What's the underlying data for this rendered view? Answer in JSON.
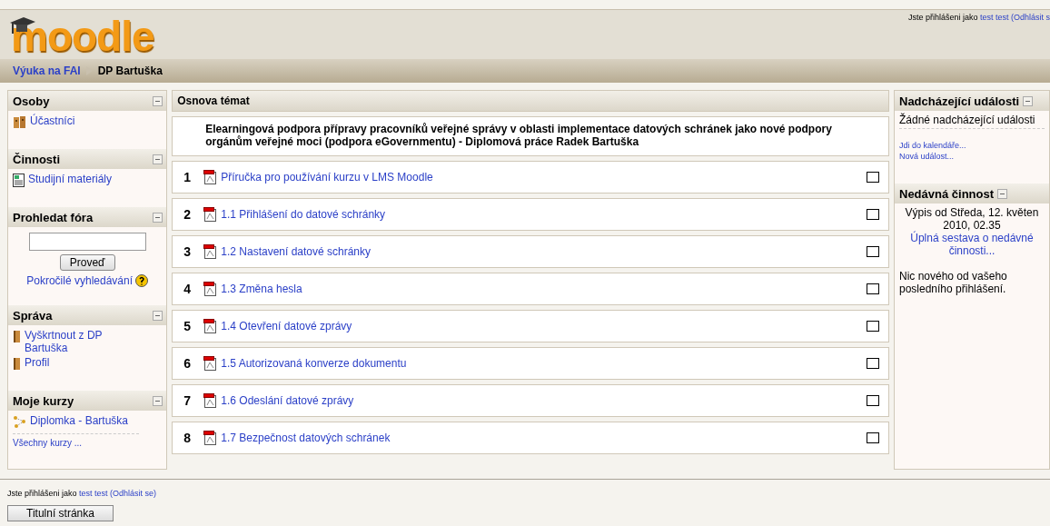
{
  "header": {
    "logo": "moodle",
    "login_prefix": "Jste přihlášeni jako",
    "login_user": "test test",
    "login_logout": "(Odhlásit s"
  },
  "breadcrumb": [
    {
      "label": "Výuka na FAI",
      "link": true
    },
    {
      "label": "DP Bartuška",
      "link": false
    }
  ],
  "left_blocks": [
    {
      "title": "Osoby",
      "kind": "links",
      "items": [
        {
          "label": "Účastníci",
          "kind": "people"
        }
      ]
    },
    {
      "title": "Činnosti",
      "kind": "links",
      "items": [
        {
          "label": "Studijní materiály",
          "kind": "document"
        }
      ]
    },
    {
      "title": "Prohledat fóra",
      "kind": "search",
      "button": "Proveď",
      "advanced": "Pokročilé vyhledávání"
    },
    {
      "title": "Správa",
      "kind": "links",
      "items": [
        {
          "label": "Vyškrtnout z DP Bartuška",
          "kind": "person"
        },
        {
          "label": "Profil",
          "kind": "person"
        }
      ]
    },
    {
      "title": "Moje kurzy",
      "kind": "links",
      "items": [
        {
          "label": "Diplomka - Bartuška",
          "kind": "course"
        }
      ],
      "footer": "Všechny kurzy ..."
    }
  ],
  "main": {
    "title": "Osnova témat",
    "summary": "Elearningová podpora přípravy pracovníků veřejné správy v oblasti implementace datových schránek jako nové podpory orgánům veřejné moci (podpora eGovernmentu) - Diplomová práce Radek Bartuška",
    "sections": [
      {
        "number": "1",
        "title": "Příručka pro používání kurzu v LMS Moodle",
        "checked": false
      },
      {
        "number": "2",
        "title": "1.1 Přihlášení do datové schránky",
        "checked": false
      },
      {
        "number": "3",
        "title": "1.2 Nastavení datové schránky",
        "checked": false
      },
      {
        "number": "4",
        "title": "1.3 Změna hesla",
        "checked": false
      },
      {
        "number": "5",
        "title": "1.4 Otevření datové zprávy",
        "checked": false
      },
      {
        "number": "6",
        "title": "1.5 Autorizovaná konverze dokumentu",
        "checked": false
      },
      {
        "number": "7",
        "title": "1.6 Odeslání datové zprávy",
        "checked": false
      },
      {
        "number": "8",
        "title": "1.7 Bezpečnost datových schránek",
        "checked": false
      }
    ]
  },
  "right_blocks": [
    {
      "title": "Nadcházející události",
      "kind": "events",
      "text": "Žádné nadcházející události",
      "links": [
        "Jdi do kalendáře...",
        "Nová událost..."
      ]
    },
    {
      "title": "Nedávná činnost",
      "kind": "recent",
      "since": "Výpis od Středa, 12. květen 2010, 02.35",
      "report": "Úplná sestava o nedávné činnosti...",
      "text": "Nic nového od vašeho posledního přihlášení."
    }
  ],
  "footer": {
    "login_prefix": "Jste přihlášeni jako",
    "login_user": "test test",
    "login_logout": "(Odhlásit se)",
    "home_button": "Titulní stránka"
  }
}
